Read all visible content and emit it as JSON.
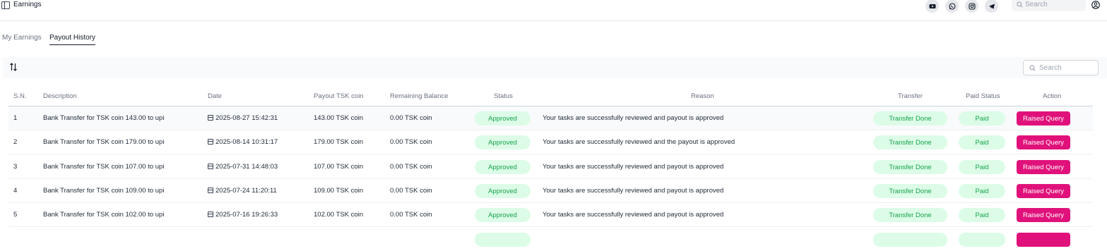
{
  "header": {
    "title": "Earnings",
    "social_icons": [
      "youtube-icon",
      "whatsapp-icon",
      "instagram-icon",
      "telegram-icon"
    ],
    "search_placeholder": "Search"
  },
  "tabs": [
    {
      "label": "My Earnings",
      "active": false
    },
    {
      "label": "Payout History",
      "active": true
    }
  ],
  "toolbar": {
    "search_placeholder": "Search"
  },
  "table": {
    "columns": [
      "S.N.",
      "Description",
      "Date",
      "Payout TSK coin",
      "Remaining Balance",
      "Status",
      "Reason",
      "Transfer",
      "Paid Status",
      "Action"
    ],
    "rows": [
      {
        "sn": "1",
        "description": "Bank Transfer for TSK coin 143.00 to upi",
        "date": "2025-08-27 15:42:31",
        "payout": "143.00 TSK coin",
        "balance": "0.00 TSK coin",
        "status": "Approved",
        "reason": "Your tasks are successfully reviewed and payout is approved",
        "transfer": "Transfer Done",
        "paid": "Paid",
        "action": "Raised Query"
      },
      {
        "sn": "2",
        "description": "Bank Transfer for TSK coin 179.00 to upi",
        "date": "2025-08-14 10:31:17",
        "payout": "179.00 TSK coin",
        "balance": "0.00 TSK coin",
        "status": "Approved",
        "reason": "Your tasks are successfully reviewed and the payout is approved",
        "transfer": "Transfer Done",
        "paid": "Paid",
        "action": "Raised Query"
      },
      {
        "sn": "3",
        "description": "Bank Transfer for TSK coin 107.00 to upi",
        "date": "2025-07-31 14:48:03",
        "payout": "107.00 TSK coin",
        "balance": "0.00 TSK coin",
        "status": "Approved",
        "reason": "Your tasks are successfully reviewed and payout is approved",
        "transfer": "Transfer Done",
        "paid": "Paid",
        "action": "Raised Query"
      },
      {
        "sn": "4",
        "description": "Bank Transfer for TSK coin 109.00 to upi",
        "date": "2025-07-24 11:20:11",
        "payout": "109.00 TSK coin",
        "balance": "0.00 TSK coin",
        "status": "Approved",
        "reason": "Your tasks are successfully reviewed and payout is approved",
        "transfer": "Transfer Done",
        "paid": "Paid",
        "action": "Raised Query"
      },
      {
        "sn": "5",
        "description": "Bank Transfer for TSK coin 102.00 to upi",
        "date": "2025-07-16 19:26:33",
        "payout": "102.00 TSK coin",
        "balance": "0.00 TSK coin",
        "status": "Approved",
        "reason": "Your tasks are successfully reviewed and payout is approved",
        "transfer": "Transfer Done",
        "paid": "Paid",
        "action": "Raised Query"
      }
    ]
  },
  "colors": {
    "accent": "#e0117a",
    "success_bg": "#dcfce7",
    "success_text": "#16a34a"
  }
}
